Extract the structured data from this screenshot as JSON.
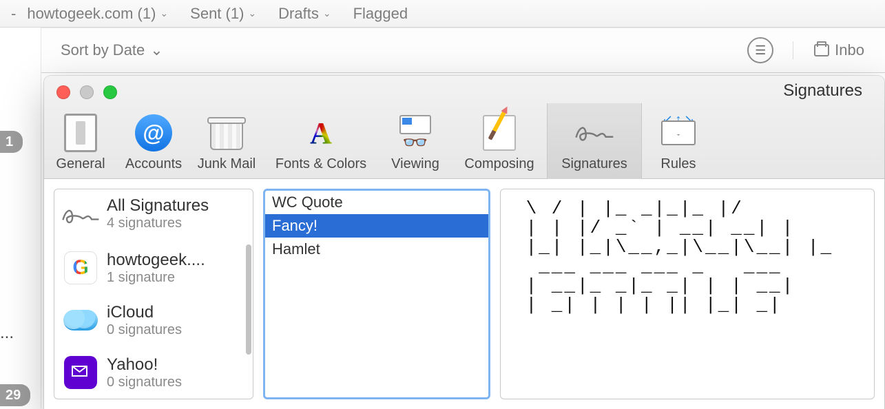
{
  "bg_toolbar": {
    "tabs": [
      {
        "label": "howtogeek.com (1)"
      },
      {
        "label": "Sent (1)"
      },
      {
        "label": "Drafts"
      },
      {
        "label": "Flagged"
      }
    ],
    "sort_label": "Sort by Date",
    "inbox_label": "Inbo"
  },
  "left_badges": {
    "top_count": "1",
    "bottom_count": "29",
    "truncated_text": "..."
  },
  "pref": {
    "title": "Signatures",
    "tabs": [
      {
        "id": "general",
        "label": "General"
      },
      {
        "id": "accounts",
        "label": "Accounts"
      },
      {
        "id": "junk",
        "label": "Junk Mail"
      },
      {
        "id": "fonts",
        "label": "Fonts & Colors"
      },
      {
        "id": "viewing",
        "label": "Viewing"
      },
      {
        "id": "composing",
        "label": "Composing"
      },
      {
        "id": "signatures",
        "label": "Signatures",
        "active": true
      },
      {
        "id": "rules",
        "label": "Rules"
      }
    ]
  },
  "accounts": [
    {
      "id": "all",
      "name": "All Signatures",
      "sub": "4 signatures"
    },
    {
      "id": "google",
      "name": "howtogeek....",
      "sub": "1 signature"
    },
    {
      "id": "icloud",
      "name": "iCloud",
      "sub": "0 signatures"
    },
    {
      "id": "yahoo",
      "name": "Yahoo!",
      "sub": "0 signatures"
    }
  ],
  "signatures": [
    {
      "name": "WC Quote"
    },
    {
      "name": "Fancy!",
      "selected": true
    },
    {
      "name": "Hamlet"
    }
  ],
  "preview_ascii": " \\ / | |_ _|_|_ |/\n | | |/ _` | __| __| | \n |_| |_|\\__,_|\\__|\\__| |_\n  ___ ___ ___ _   ___\n | __|_ _|_ _| | | __|\n | _| | | | || |_| _|"
}
